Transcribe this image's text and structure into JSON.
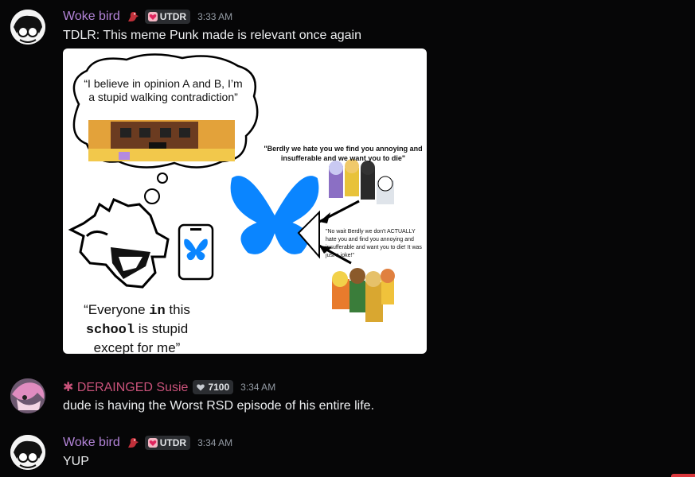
{
  "messages": [
    {
      "username": "Woke bird",
      "name_color": "#b384d8",
      "tag": "UTDR",
      "timestamp": "3:33 AM",
      "text": "TDLR: This meme Punk made is relevant once again"
    },
    {
      "username": "✱ DERAINGED Susie",
      "name_color": "#c9527a",
      "tag": "7100",
      "timestamp": "3:34 AM",
      "text": "dude is having the Worst RSD episode of his entire life."
    },
    {
      "username": "Woke bird",
      "name_color": "#b384d8",
      "tag": "UTDR",
      "timestamp": "3:34 AM",
      "text": "YUP"
    }
  ],
  "meme": {
    "thought_text": "“I believe in opinion A and B, I’m a stupid walking contradiction”",
    "crowd_quote_1": "\"Berdly we hate you we find you annoying and insufferable and  we want you to die\"",
    "crowd_quote_2": "\"No wait Berdly we don't ACTUALLY hate you and find you annoying and insufferable and want you to die! It was just a joke!\"",
    "bottom_caption_1": "“Everyone ",
    "bottom_caption_in": "in",
    "bottom_caption_2": " this",
    "bottom_caption_school": "school",
    "bottom_caption_3": " is stupid",
    "bottom_caption_4": "except for me”"
  },
  "icons": {
    "badge_tag": "heart-badge-icon",
    "role_icon": "bird-icon",
    "platform_logo": "butterfly-icon"
  },
  "colors": {
    "background": "#060607",
    "butterfly": "#0a85ff",
    "tag_badge": "#2b2d31"
  }
}
